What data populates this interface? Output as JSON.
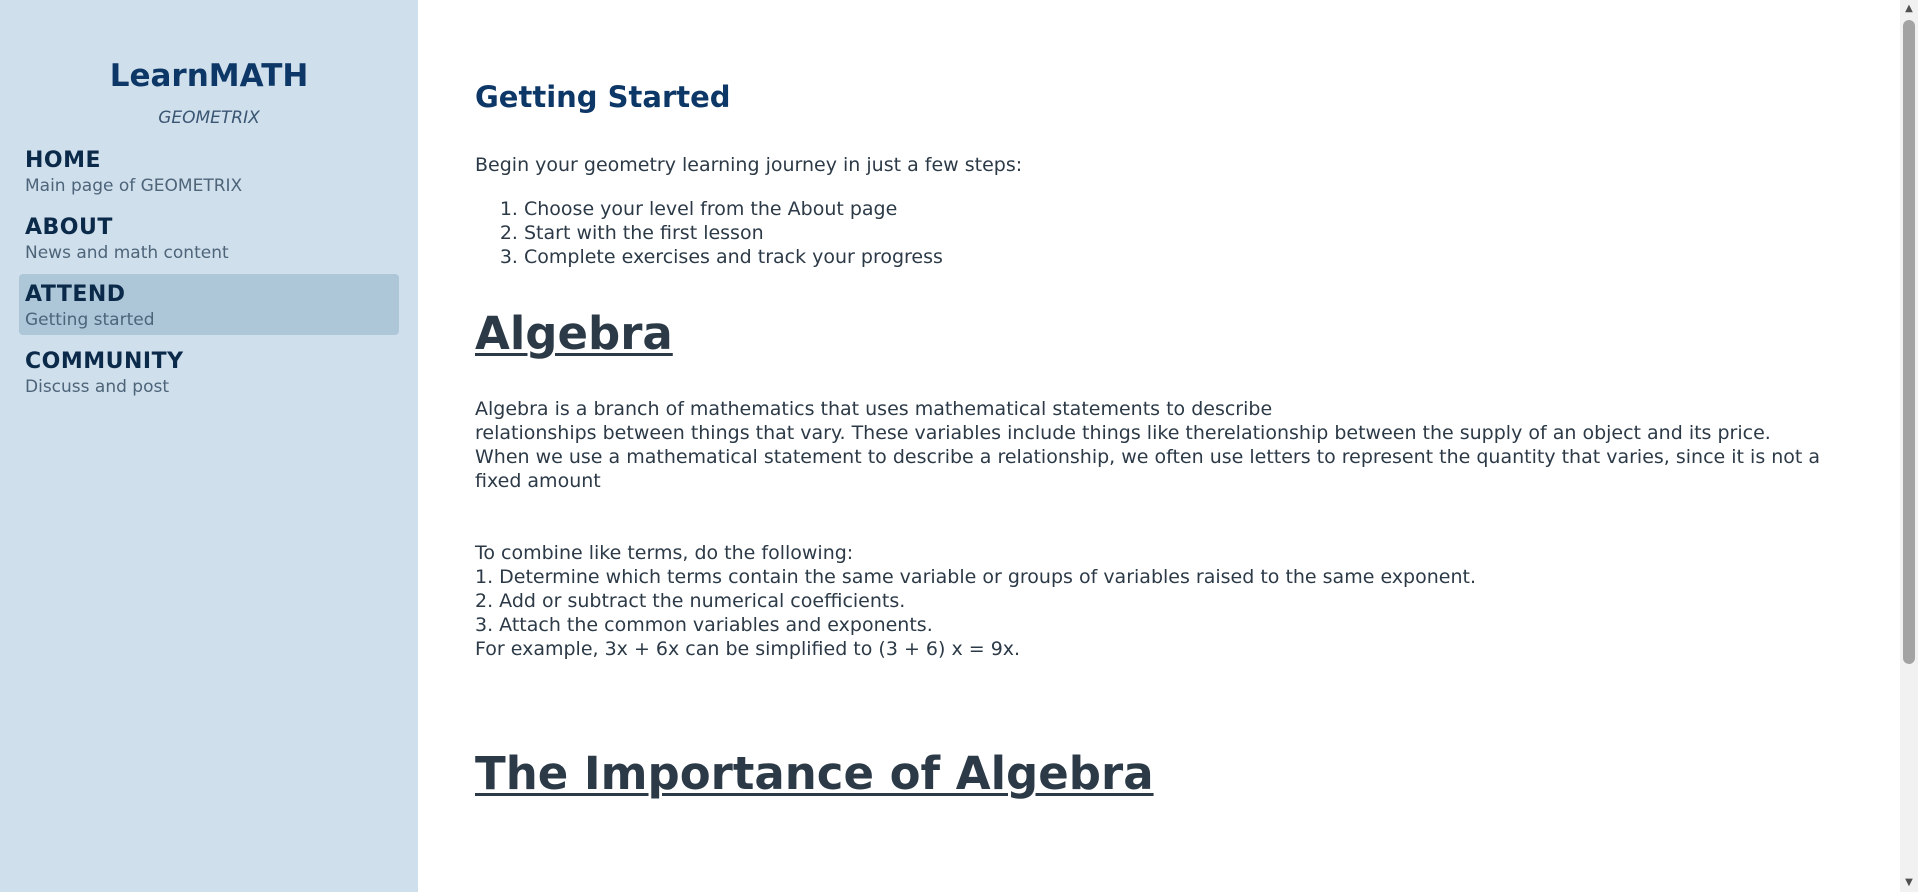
{
  "sidebar": {
    "brand": "LearnMATH",
    "tagline": "GEOMETRIX",
    "items": [
      {
        "title": "HOME",
        "subtitle": "Main page of GEOMETRIX"
      },
      {
        "title": "ABOUT",
        "subtitle": "News and math content"
      },
      {
        "title": "ATTEND",
        "subtitle": "Getting started",
        "active": true
      },
      {
        "title": "COMMUNITY",
        "subtitle": "Discuss and post"
      }
    ]
  },
  "main": {
    "getting_started": {
      "title": "Getting Started",
      "intro": "Begin your geometry learning journey in just a few steps:",
      "steps": [
        "Choose your level from the About page",
        "Start with the first lesson",
        "Complete exercises and track your progress"
      ]
    },
    "algebra": {
      "heading": "Algebra",
      "para1_lines": [
        "Algebra is a branch of mathematics that uses mathematical statements to describe",
        "relationships between things that vary. These variables include things like therelationship between the supply of an object and its price.",
        "When we use a mathematical statement to describe a relationship, we often use letters to represent the quantity that varies, since it is not a",
        "fixed amount"
      ],
      "para2_lines": [
        "To combine like terms, do the following:",
        "1. Determine which terms contain the same variable or groups of variables raised to the same exponent.",
        "2. Add or subtract the numerical coefficients.",
        "3. Attach the common variables and exponents.",
        "For example, 3x + 6x can be simplified to (3 + 6) x = 9x."
      ]
    },
    "importance": {
      "heading": "The Importance of Algebra"
    }
  },
  "scrollbar": {
    "up_icon": "triangle-up",
    "down_icon": "triangle-down",
    "position_fraction": 0.0
  },
  "colors": {
    "sidebar_bg": "#cfdfec",
    "active_item_bg": "#adc6d8",
    "brand": "#0d3766",
    "text": "#2c3a47"
  }
}
